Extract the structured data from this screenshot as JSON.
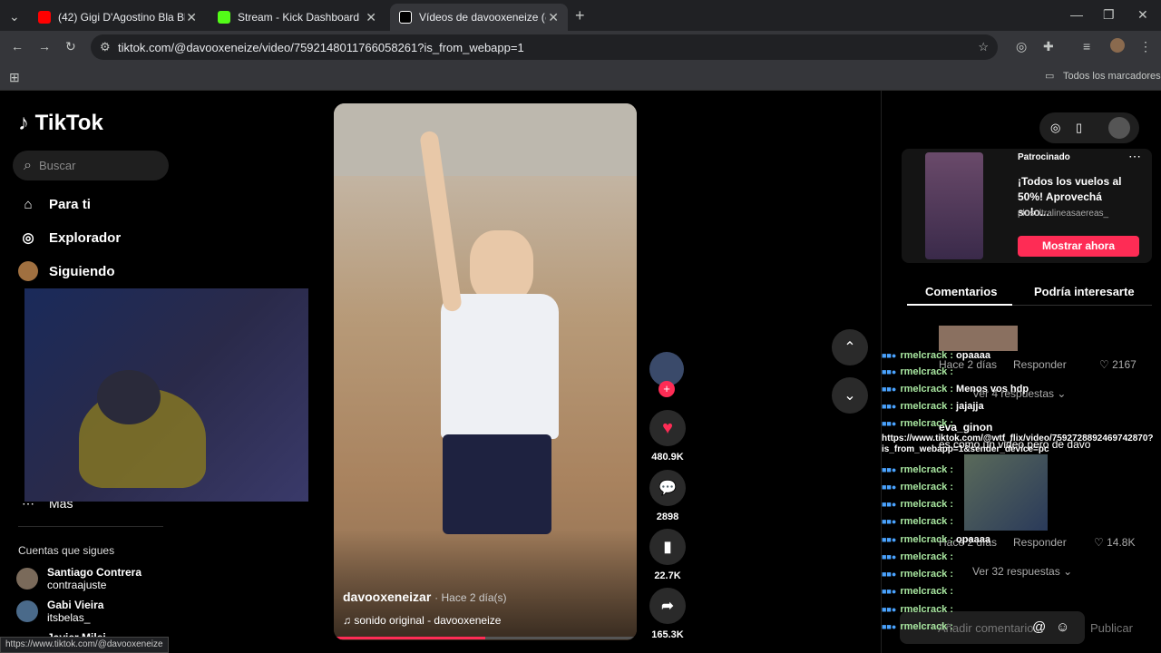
{
  "browser": {
    "tabs": [
      {
        "label": "(42) Gigi D'Agostino Bla Bla Bla",
        "color": "#ff0000"
      },
      {
        "label": "Stream - Kick Dashboard",
        "color": "#53fc18"
      },
      {
        "label": "Vídeos de davooxeneize (@",
        "color": "#ffffff"
      }
    ],
    "new_tab": "+",
    "url": "tiktok.com/@davooxeneize/video/7592148011766058261?is_from_webapp=1",
    "bookmarks_label": "Todos los marcadores"
  },
  "tiktok": {
    "logo": "TikTok",
    "search_placeholder": "Buscar",
    "nav": [
      "Para ti",
      "Explorador",
      "Siguiendo"
    ],
    "more": "Más",
    "following_header": "Cuentas que sigues",
    "following": [
      {
        "name": "Santiago Contrera",
        "handle": "contraajuste"
      },
      {
        "name": "Gabi Vieira",
        "handle": "itsbelas_"
      },
      {
        "name": "Javier Milei",
        "handle": ""
      }
    ],
    "status_url": "https://www.tiktok.com/@davooxeneize"
  },
  "video": {
    "author": "davooxeneizar",
    "time": "· Hace 2 día(s)",
    "sound": "sonido original - davooxeneize",
    "likes": "480.9K",
    "comments": "2898",
    "saves": "22.7K",
    "shares": "165.3K",
    "progress": 0.5
  },
  "ad": {
    "sponsored": "Patrocinado",
    "title": "¡Todos los vuelos al 50%! Aprovechá solo...",
    "domain": "plusultralineasaereas_",
    "cta": "Mostrar ahora"
  },
  "comments_tabs": [
    "Comentarios",
    "Podría interesarte"
  ],
  "comment_meta": [
    {
      "time": "Hace 2 días",
      "reply": "Responder",
      "likes": "2167",
      "replies": "Ver 4 respuestas"
    },
    {
      "time": "Hace 2 días",
      "reply": "Responder",
      "likes": "14.8K",
      "replies": "Ver 32 respuestas"
    }
  ],
  "comment_texts": [
    "opaaaa",
    "eva_ginon",
    "es como un video pero de davo"
  ],
  "comment_input": {
    "placeholder": "Añadir comentario...",
    "post": "Publicar"
  },
  "chat": [
    {
      "user": "rmelcrack :",
      "msg": "opaaaa"
    },
    {
      "user": "rmelcrack :",
      "msg": ""
    },
    {
      "user": "rmelcrack :",
      "msg": "Menos vos hdp"
    },
    {
      "user": "rmelcrack :",
      "msg": "jajajja"
    },
    {
      "user": "rmelcrack :",
      "msg": ""
    },
    {
      "user": "",
      "msg": "https://www.tiktok.com/@wtf_flix/video/7592728892469742870?is_from_webapp=1&sender_device=pc"
    },
    {
      "user": "rmelcrack :",
      "msg": ""
    },
    {
      "user": "rmelcrack :",
      "msg": ""
    },
    {
      "user": "rmelcrack :",
      "msg": ""
    },
    {
      "user": "rmelcrack :",
      "msg": ""
    },
    {
      "user": "rmelcrack :",
      "msg": "opaaaa"
    },
    {
      "user": "rmelcrack :",
      "msg": ""
    },
    {
      "user": "rmelcrack :",
      "msg": ""
    },
    {
      "user": "rmelcrack :",
      "msg": ""
    },
    {
      "user": "rmelcrack :",
      "msg": ""
    },
    {
      "user": "rmelcrack :",
      "msg": ""
    }
  ],
  "colors": {
    "accent": "#fe2c55",
    "bg": "#000000"
  }
}
